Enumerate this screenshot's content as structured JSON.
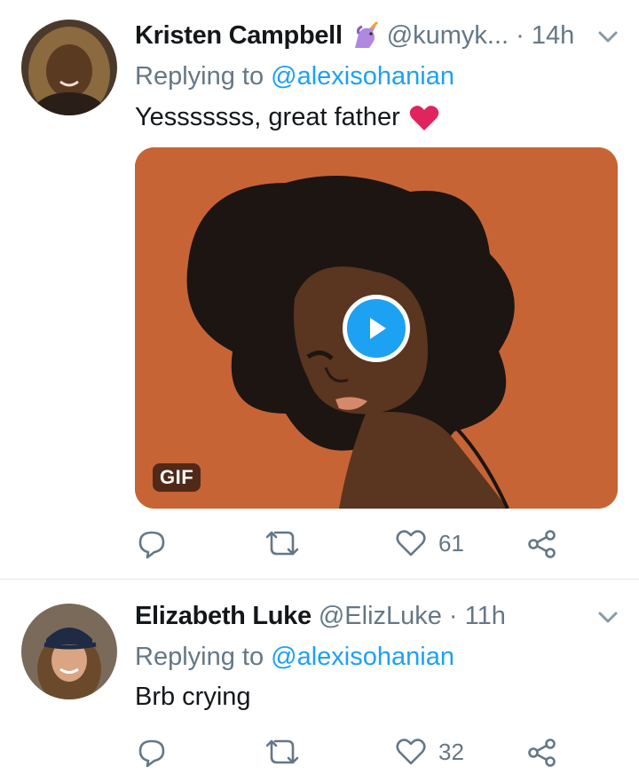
{
  "tweets": [
    {
      "name": "Kristen Campbell",
      "badge_icon": "unicorn-icon",
      "handle": "@kumyk...",
      "time": "· 14h",
      "replying_prefix": "Replying to ",
      "replying_handle": "@alexisohanian",
      "text": "Yesssssss, great father",
      "text_icon": "heart-icon",
      "media": {
        "badge": "GIF",
        "bg": "#c76436"
      },
      "likes": "61"
    },
    {
      "name": "Elizabeth Luke",
      "handle": "@ElizLuke",
      "time": "· 11h",
      "replying_prefix": "Replying to ",
      "replying_handle": "@alexisohanian",
      "text": "Brb crying",
      "likes": "32"
    }
  ],
  "colors": {
    "link": "#1da1f2",
    "muted": "#657786",
    "heart": "#e0245e"
  }
}
